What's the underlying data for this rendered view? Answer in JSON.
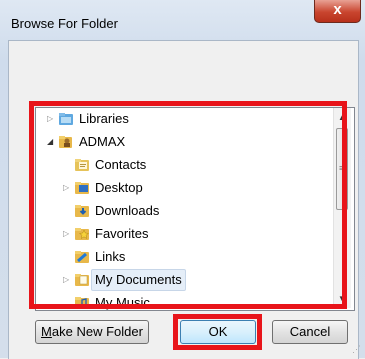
{
  "window": {
    "title": "Browse For Folder",
    "close_glyph": "x"
  },
  "tree": {
    "items": [
      {
        "label": "Libraries",
        "icon": "libraries-icon",
        "expander": "▷",
        "level": 1
      },
      {
        "label": "ADMAX",
        "icon": "user-folder-icon",
        "expander": "◢",
        "level": 1
      },
      {
        "label": "Contacts",
        "icon": "contacts-folder-icon",
        "expander": "",
        "level": 2
      },
      {
        "label": "Desktop",
        "icon": "desktop-folder-icon",
        "expander": "▷",
        "level": 2
      },
      {
        "label": "Downloads",
        "icon": "downloads-folder-icon",
        "expander": "",
        "level": 2
      },
      {
        "label": "Favorites",
        "icon": "favorites-folder-icon",
        "expander": "▷",
        "level": 2
      },
      {
        "label": "Links",
        "icon": "links-folder-icon",
        "expander": "",
        "level": 2
      },
      {
        "label": "My Documents",
        "icon": "documents-folder-icon",
        "expander": "▷",
        "level": 2,
        "selected": true
      },
      {
        "label": "My Music",
        "icon": "music-folder-icon",
        "expander": "",
        "level": 2
      }
    ]
  },
  "buttons": {
    "make_new_folder": {
      "label": "Make New Folder",
      "accel": "M",
      "rest": "ake New Folder"
    },
    "ok": {
      "label": "OK"
    },
    "cancel": {
      "label": "Cancel"
    }
  },
  "colors": {
    "highlight": "#e8141a",
    "close_red": "#c9452f",
    "selection": "#e5eef8"
  }
}
